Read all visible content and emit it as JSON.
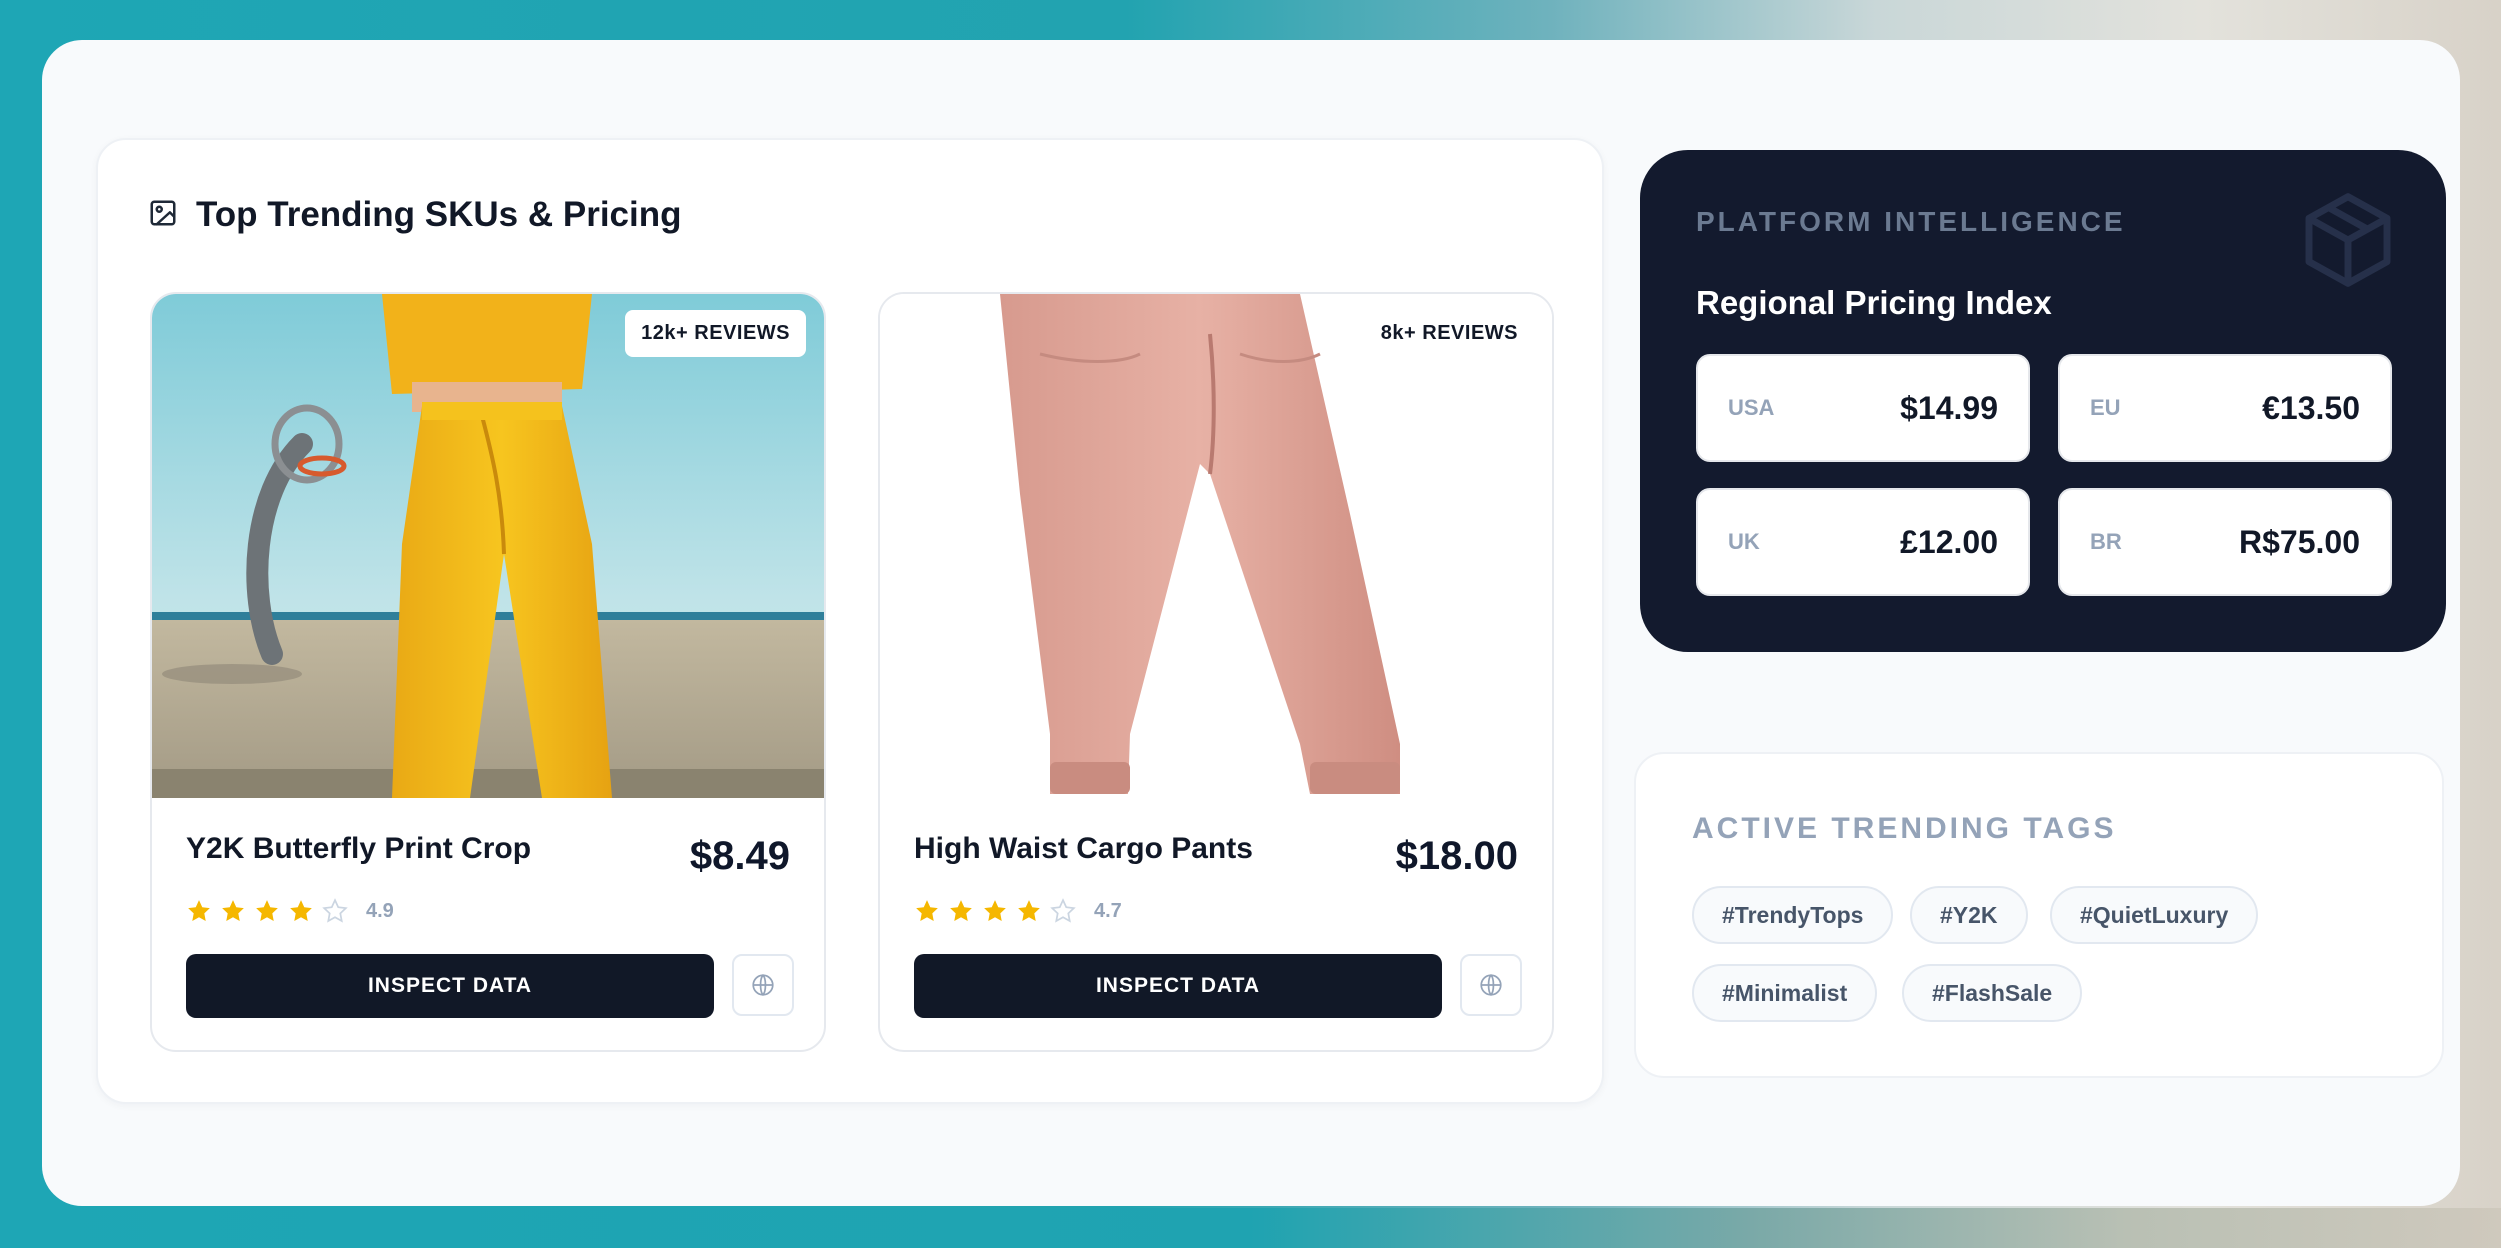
{
  "skus": {
    "title": "Top Trending SKUs & Pricing",
    "products": [
      {
        "name": "Y2K Butterfly Print Crop",
        "price": "$8.49",
        "reviews_badge": "12k+ REVIEWS",
        "rating": "4.9",
        "stars_filled": 4,
        "inspect_label": "INSPECT DATA"
      },
      {
        "name": "High Waist Cargo Pants",
        "price": "$18.00",
        "reviews_badge": "8k+ REVIEWS",
        "rating": "4.7",
        "stars_filled": 4,
        "inspect_label": "INSPECT DATA"
      }
    ]
  },
  "intel": {
    "eyebrow": "PLATFORM INTELLIGENCE",
    "title": "Regional Pricing Index",
    "regions": [
      {
        "code": "USA",
        "price": "$14.99"
      },
      {
        "code": "EU",
        "price": "€13.50"
      },
      {
        "code": "UK",
        "price": "£12.00"
      },
      {
        "code": "BR",
        "price": "R$75.00"
      }
    ]
  },
  "tags": {
    "title": "ACTIVE TRENDING TAGS",
    "items": [
      "#TrendyTops",
      "#Y2K",
      "#QuietLuxury",
      "#Minimalist",
      "#FlashSale"
    ]
  },
  "colors": {
    "accent_dark": "#111827",
    "star": "#f5b700",
    "star_empty": "#cbd5e1",
    "background_teal": "#1ea6b5"
  }
}
